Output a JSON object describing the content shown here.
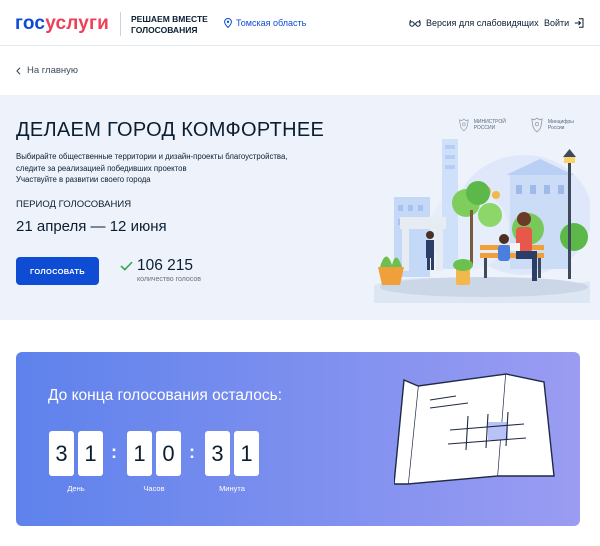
{
  "header": {
    "logo_part1": "гос",
    "logo_part2": "услуги",
    "tagline": "РЕШАЕМ ВМЕСТЕ ГОЛОСОВАНИЯ",
    "region": "Томская область",
    "region_icon": "location-pin-icon",
    "accessibility": "Версия для слабовидящих",
    "accessibility_icon": "glasses-icon",
    "login": "Войти",
    "login_icon": "login-icon"
  },
  "breadcrumb": {
    "back_label": "На главную",
    "icon": "chevron-left-icon"
  },
  "hero": {
    "title": "ДЕЛАЕМ ГОРОД КОМФОРТНЕЕ",
    "description_lines": [
      "Выбирайте общественные территории и дизайн-проекты благоустройства,",
      "следите за реализацией победивших проектов",
      "Участвуйте в развитии своего города"
    ],
    "period_label": "ПЕРИОД ГОЛОСОВАНИЯ",
    "period": "21 апреля — 12 июня",
    "vote_button": "ГОЛОСОВАТЬ",
    "votes_count": "106 215",
    "votes_label": "количество голосов",
    "votes_icon": "checkmark-icon",
    "ministries": [
      {
        "name": "МИНИСТРОЙ РОССИИ",
        "icon": "coat-of-arms-icon"
      },
      {
        "name": "Минцифры России",
        "icon": "coat-of-arms-icon"
      }
    ],
    "illustration": "city-park-illustration"
  },
  "countdown": {
    "title": "До конца голосования осталось:",
    "groups": [
      {
        "digits": [
          "3",
          "1"
        ],
        "unit": "День"
      },
      {
        "digits": [
          "1",
          "0"
        ],
        "unit": "Часов"
      },
      {
        "digits": [
          "3",
          "1"
        ],
        "unit": "Минута"
      }
    ],
    "illustration": "calendar-icon"
  },
  "colors": {
    "primary": "#0d4cd3",
    "brand_red": "#ee3f58",
    "hero_bg": "#eef2fa",
    "countdown_start": "#5e82ec",
    "countdown_end": "#9b9cf2",
    "check_green": "#35a852"
  }
}
